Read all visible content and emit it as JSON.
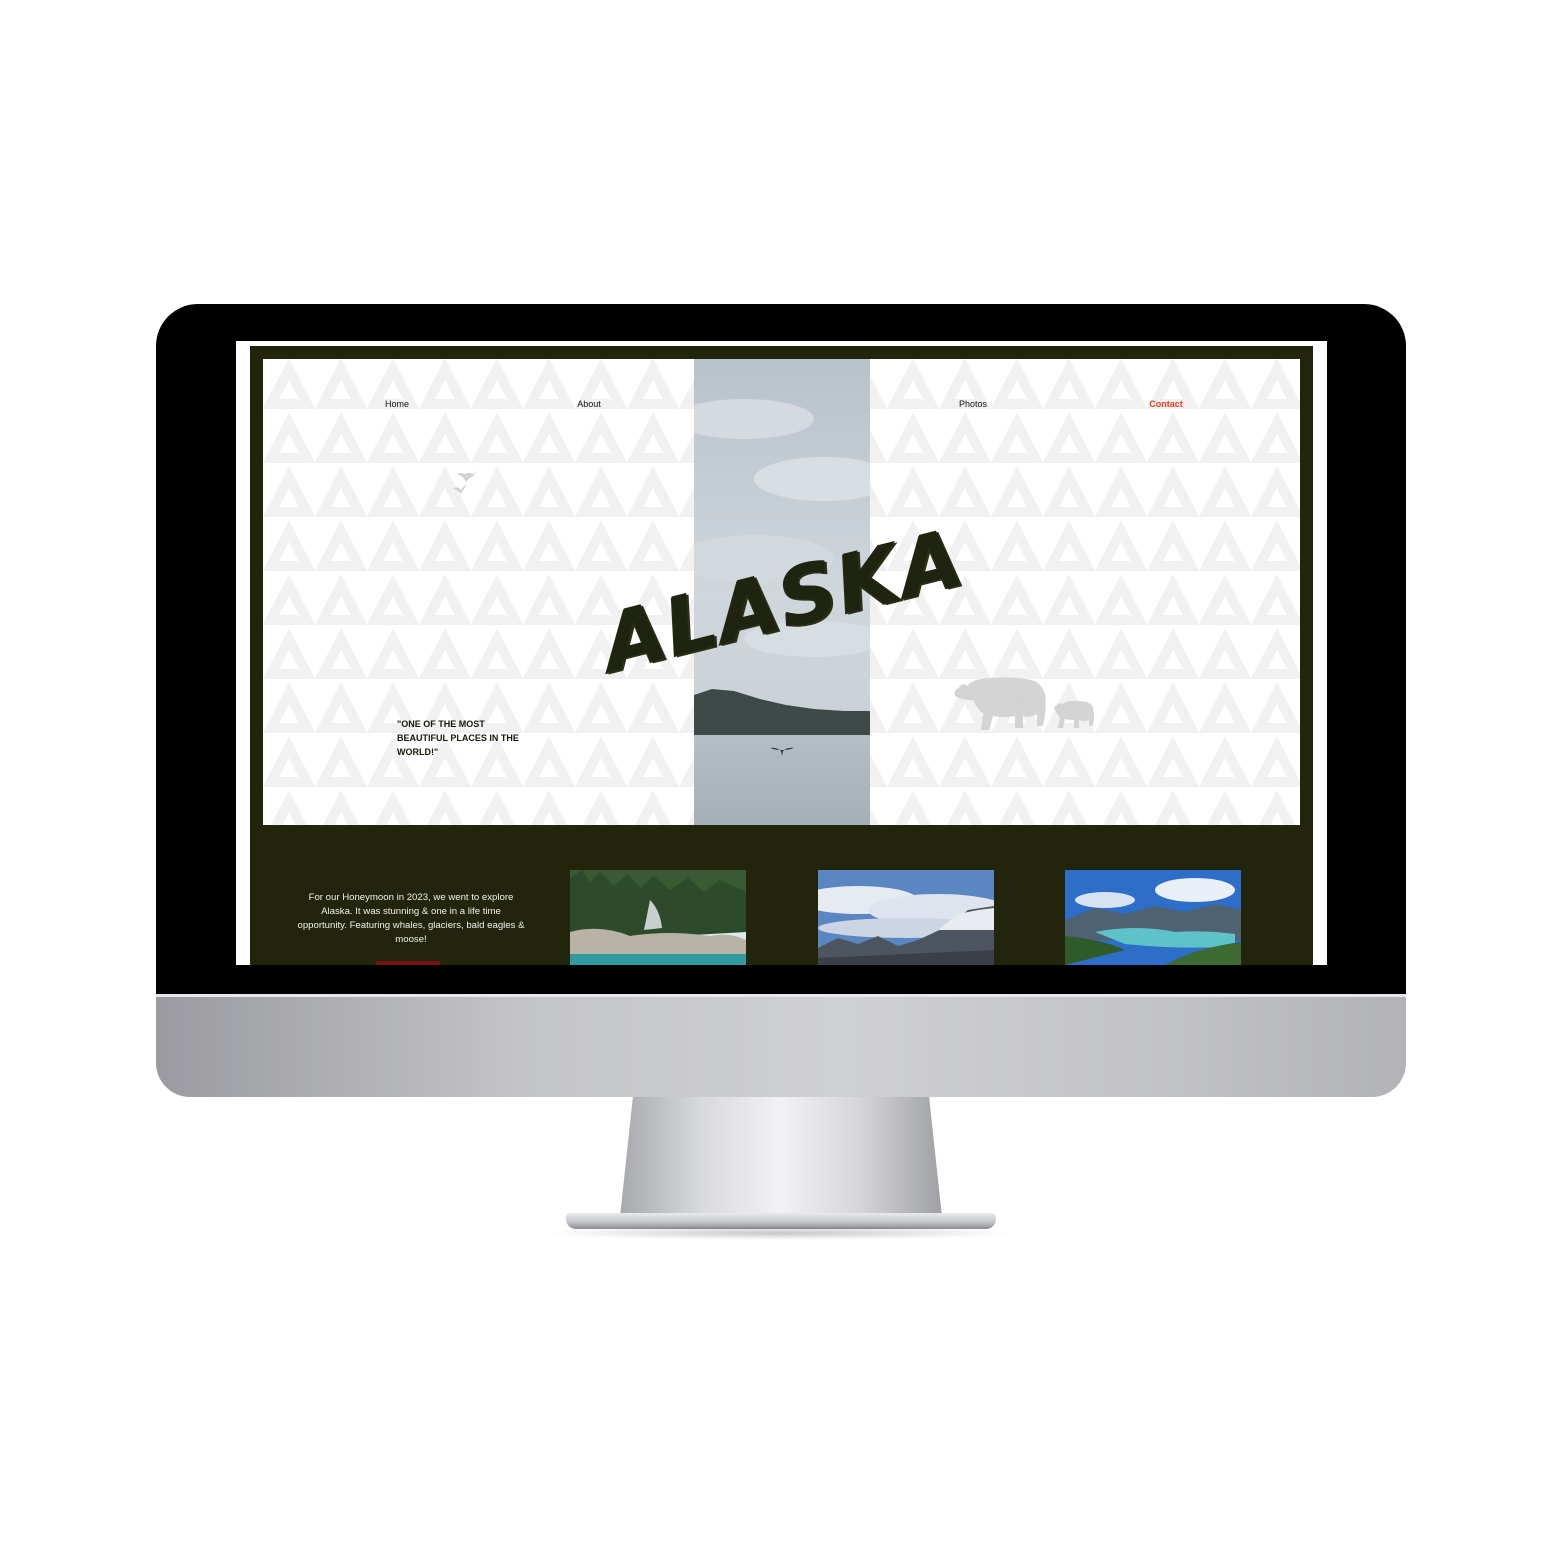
{
  "nav": {
    "home": "Home",
    "about": "About",
    "photos": "Photos",
    "contact": "Contact"
  },
  "hero": {
    "title": "ALASKA",
    "quote": "\"ONE OF THE MOST BEAUTIFUL PLACES IN THE WORLD!\""
  },
  "about": {
    "text": "For our Honeymoon in 2023, we went to explore Alaska. It was stunning & one in a life time opportunity. Featuring whales, glaciers, bald eagles & moose!"
  },
  "colors": {
    "frame": "#22250c",
    "accent": "#e8401c",
    "title": "#1f2410"
  },
  "icons": [
    "eagle-icon",
    "bear-icon",
    "bear-cub-icon",
    "whale-tail-icon"
  ]
}
